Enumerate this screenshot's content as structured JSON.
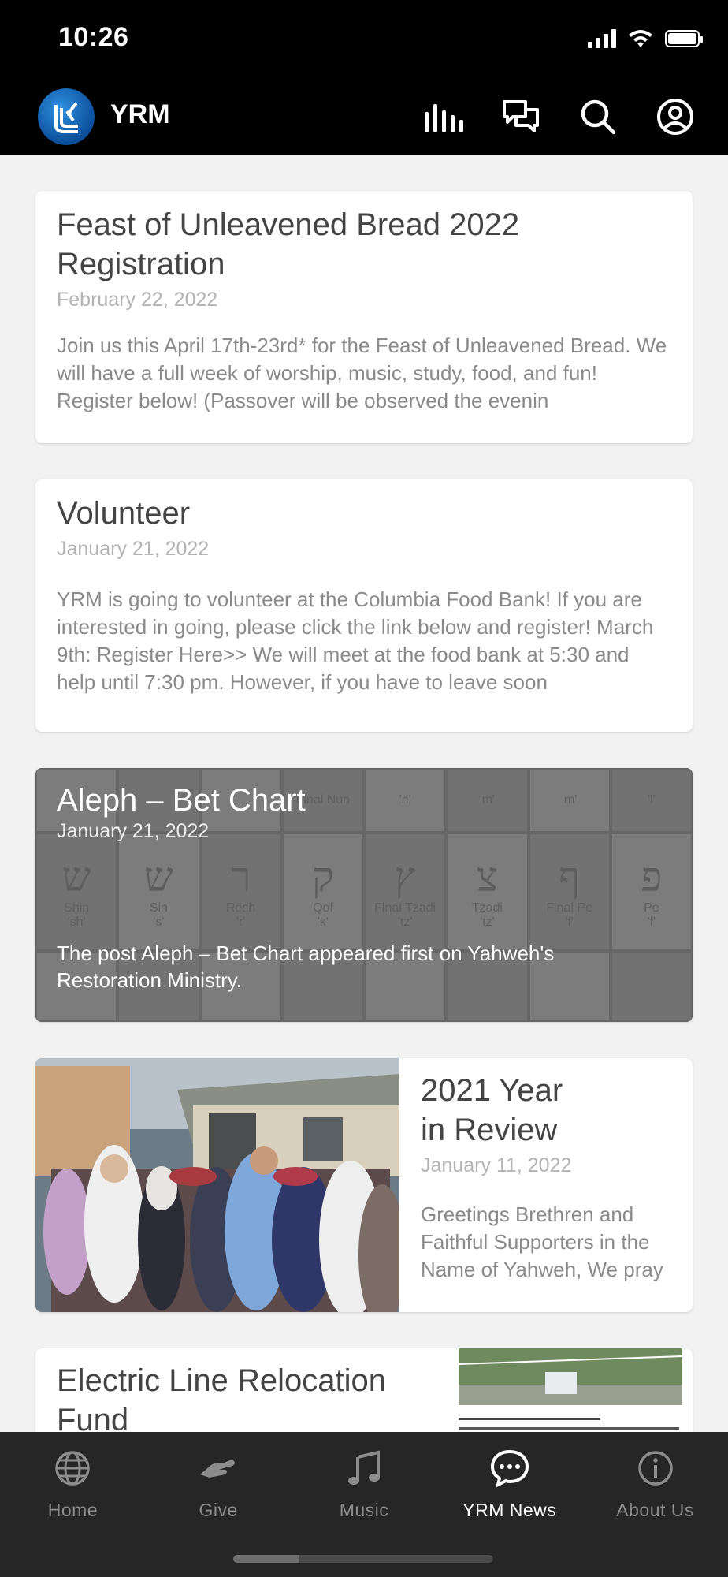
{
  "status": {
    "time": "10:26"
  },
  "app": {
    "title": "YRM"
  },
  "posts": [
    {
      "title": "Feast of Unleavened Bread 2022 Registration",
      "date": "February 22, 2022",
      "excerpt": "Join us this April 17th-23rd* for the Feast of Unleavened Bread. We will have a full week of worship, music, study, food, and fun! Register below! (Passover will be observed the evenin"
    },
    {
      "title": "Volunteer",
      "date": "January 21, 2022",
      "excerpt": "YRM is going to volunteer at the Columbia Food Bank! If you are interested in going, please click the link below and register! March 9th: Register Here>> We will meet at the food bank at 5:30 and help until 7:30 pm. However, if you have to leave soon"
    },
    {
      "title": "Aleph – Bet Chart",
      "date": "January 21, 2022",
      "excerpt": "The post Aleph – Bet Chart appeared first on Yahweh's Restoration Ministry."
    },
    {
      "title": "2021 Year in Review",
      "date": "January 11, 2022",
      "excerpt": "Greetings Brethren and Faithful Supporters in the Name of Yahweh, We pray"
    },
    {
      "title": "Electric Line Relocation Fund"
    }
  ],
  "chart_image": {
    "top_row": [
      "",
      "",
      "",
      "Final Nun",
      "'n'",
      "'m'",
      "'m'",
      "'l'"
    ],
    "letters": [
      {
        "glyph": "ש",
        "name": "Shin",
        "sound": "'sh'"
      },
      {
        "glyph": "ש",
        "name": "Sin",
        "sound": "'s'"
      },
      {
        "glyph": "ר",
        "name": "Resh",
        "sound": "'r'"
      },
      {
        "glyph": "ק",
        "name": "Qof",
        "sound": "'k'"
      },
      {
        "glyph": "ץ",
        "name": "Final Tzadi",
        "sound": "'tz'"
      },
      {
        "glyph": "צ",
        "name": "Tzadi",
        "sound": "'tz'"
      },
      {
        "glyph": "ף",
        "name": "Final Pe",
        "sound": "'f'"
      },
      {
        "glyph": "פ",
        "name": "Pe",
        "sound": "'f'"
      }
    ]
  },
  "tabs": [
    {
      "label": "Home",
      "icon": "globe-icon",
      "active": false
    },
    {
      "label": "Give",
      "icon": "give-hand-icon",
      "active": false
    },
    {
      "label": "Music",
      "icon": "music-note-icon",
      "active": false
    },
    {
      "label": "YRM News",
      "icon": "news-chat-icon",
      "active": true
    },
    {
      "label": "About Us",
      "icon": "info-icon",
      "active": false
    }
  ],
  "colors": {
    "bar_bg": "#000000",
    "tab_bg": "#262626",
    "page_bg": "#f2f2f2"
  }
}
